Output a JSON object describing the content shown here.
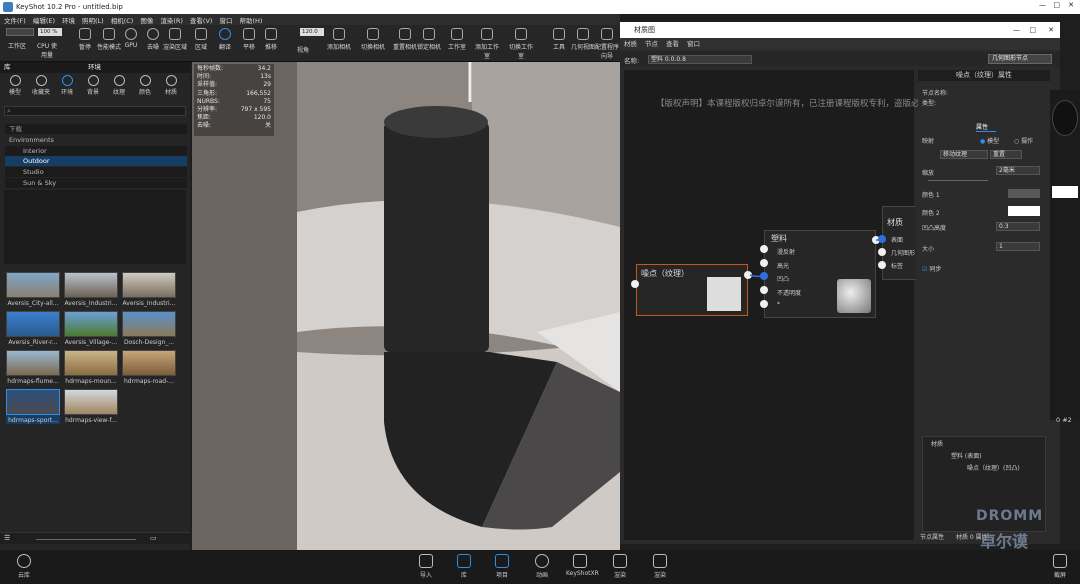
{
  "app": {
    "title": "KeyShot 10.2 Pro - untitled.bip"
  },
  "menu": [
    "文件(F)",
    "编辑(E)",
    "环境",
    "照明(L)",
    "相机(C)",
    "图像",
    "渲染(R)",
    "查看(V)",
    "窗口",
    "帮助(H)"
  ],
  "toolbar": {
    "workspace_select": "",
    "zoom_value": "100 %",
    "fov_value": "120.0",
    "items": [
      {
        "label": "工作区",
        "icon": "workspace-icon"
      },
      {
        "label": "CPU 使用量",
        "icon": "cpu-icon"
      },
      {
        "label": "暂停",
        "icon": "pause-icon"
      },
      {
        "label": "性能模式",
        "icon": "performance-icon"
      },
      {
        "label": "GPU",
        "icon": "gpu-icon"
      },
      {
        "label": "去噪",
        "icon": "denoise-icon"
      },
      {
        "label": "渲染区域",
        "icon": "region-icon"
      },
      {
        "label": "区域",
        "icon": "area-icon"
      },
      {
        "label": "翻译",
        "icon": "translate-icon"
      },
      {
        "label": "平移",
        "icon": "pan-icon"
      },
      {
        "label": "推移",
        "icon": "dolly-icon"
      },
      {
        "label": "视角",
        "icon": "perspective-icon"
      },
      {
        "label": "添加相机",
        "icon": "add-camera-icon"
      },
      {
        "label": "切换相机",
        "icon": "switch-camera-icon"
      },
      {
        "label": "重置相机",
        "icon": "reset-camera-icon"
      },
      {
        "label": "锁定相机",
        "icon": "lock-camera-icon"
      },
      {
        "label": "工作室",
        "icon": "studio-icon"
      },
      {
        "label": "添加工作室",
        "icon": "add-studio-icon"
      },
      {
        "label": "切换工作室",
        "icon": "switch-studio-icon"
      },
      {
        "label": "工具",
        "icon": "tools-icon"
      },
      {
        "label": "几何视图",
        "icon": "geometry-icon"
      },
      {
        "label": "配置程序向导",
        "icon": "wizard-icon"
      }
    ]
  },
  "library": {
    "tabs": [
      "库",
      "环境"
    ],
    "subtabs": [
      "模型",
      "收藏夹",
      "环境",
      "背景",
      "纹理",
      "颜色",
      "材质"
    ],
    "search_placeholder": "",
    "tree": [
      "Environments",
      "Interior",
      "Outdoor",
      "Studio",
      "Sun & Sky"
    ],
    "tree_header": "下载",
    "thumbs": [
      "Aversis_City-all...",
      "Aversis_Industri...",
      "Aversis_Industri...",
      "Aversis_River-r...",
      "Aversis_Village-...",
      "Dosch-Design_...",
      "hdrmaps-flume...",
      "hdrmaps-moun...",
      "hdrmaps-road-...",
      "hdrmaps-sport...",
      "hdrmaps-view-f..."
    ]
  },
  "stats": [
    {
      "k": "每秒帧数:",
      "v": "34.2"
    },
    {
      "k": "时间:",
      "v": "13s"
    },
    {
      "k": "采样值:",
      "v": "29"
    },
    {
      "k": "三角形:",
      "v": "166,552"
    },
    {
      "k": "NURBS:",
      "v": "75"
    },
    {
      "k": "分辨率:",
      "v": "797 x 595"
    },
    {
      "k": "焦距:",
      "v": "120.0"
    },
    {
      "k": "去噪:",
      "v": "关"
    }
  ],
  "material_window": {
    "title": "材质图",
    "menu": [
      "材质",
      "节点",
      "查看",
      "窗口"
    ],
    "name_label": "名称:",
    "name_value": "塑料 0.0.0.8",
    "notice": "【版权声明】本课程版权归卓尔谟所有，已注册课程版权专利，盗版必究！",
    "texture_node_title": "噪点（纹理）",
    "material_node_title": "塑料",
    "material_ports": [
      "漫反射",
      "高光",
      "凹凸",
      "不透明度",
      "*"
    ],
    "output_node_title": "材质",
    "output_ports": [
      "表面",
      "几何图形",
      "标签"
    ],
    "toolbar_button": "几何图形节点"
  },
  "props": {
    "header": "噪点（纹理）属性",
    "node_name_label": "节点名称:",
    "type_label": "类型:",
    "tab": "属性",
    "mapping_label": "映射",
    "mapping_options": [
      "模型",
      "摄作"
    ],
    "move_texture": "移动纹理",
    "reset": "重置",
    "scale_label": "缩放",
    "scale_value": "2毫米",
    "color1_label": "颜色 1",
    "color2_label": "颜色 2",
    "bump_label": "凹凸高度",
    "bump_value": "0.3",
    "size_label": "大小",
    "size_value": "1",
    "sync_label": "同步",
    "tree": [
      "材质",
      "塑料 (表面)",
      "噪点（纹理）(凹凸)"
    ],
    "footer_tabs": [
      "节点属性",
      "材质 0 属性"
    ],
    "right_label": "0 #2"
  },
  "bottom": {
    "left_label": "云库",
    "items": [
      {
        "label": "导入",
        "icon": "import-icon"
      },
      {
        "label": "库",
        "icon": "library-icon"
      },
      {
        "label": "项目",
        "icon": "project-icon"
      },
      {
        "label": "动画",
        "icon": "animation-icon"
      },
      {
        "label": "KeyShotXR",
        "icon": "xr-icon"
      },
      {
        "label": "渲染",
        "icon": "render-icon"
      },
      {
        "label": "渲染",
        "icon": "screenshot-icon"
      }
    ],
    "right_label": "截屏",
    "watermark": "DROMM",
    "watermark_cn": "卓尔谟"
  }
}
